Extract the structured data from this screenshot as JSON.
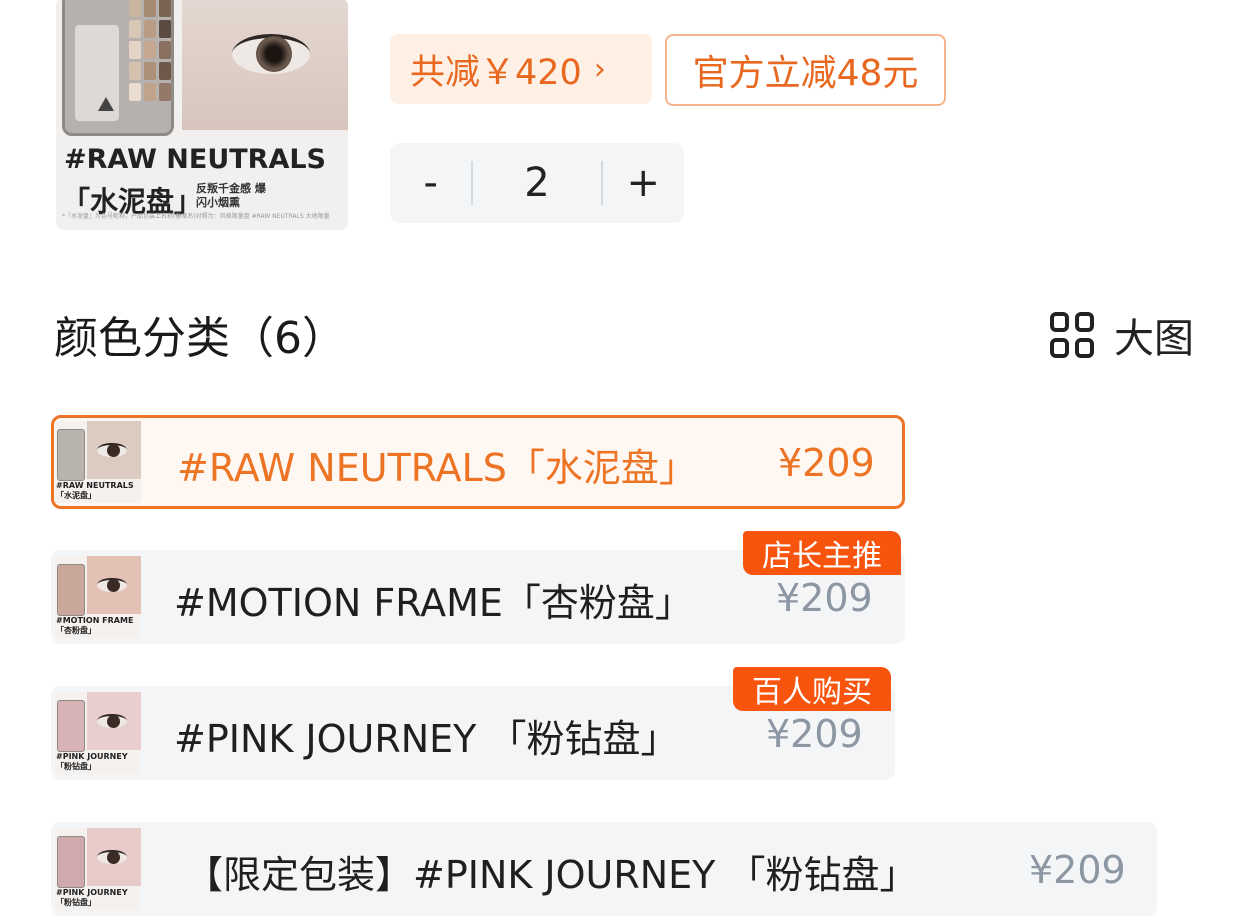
{
  "product": {
    "thumb_title": "#RAW NEUTRALS",
    "thumb_subtitle": "「水泥盘」",
    "thumb_desc": "反叛千金感 爆闪小烟熏",
    "thumb_footnote": "*「水泥盘」为色号昵称，产品包装上名称(备案名)对照为：风格限量盘 #RAW NEUTRALS 大地限量"
  },
  "price": {
    "coupon_total_label": "共减￥420",
    "coupon_total_chevron": "›",
    "coupon_official_label": "官方立减48元"
  },
  "quantity": {
    "minus": "-",
    "value": "2",
    "plus": "+"
  },
  "colors": {
    "title": "颜色分类（6）",
    "big_view_label": "大图",
    "options": [
      {
        "caption": "#RAW NEUTRALS\n「水泥盘」",
        "name": "#RAW NEUTRALS「水泥盘」",
        "price": "¥209",
        "badge": "",
        "selected": true
      },
      {
        "caption": "#MOTION FRAME\n「杏粉盘」",
        "name": "#MOTION FRAME「杏粉盘」",
        "price": "¥209",
        "badge": "店长主推",
        "selected": false
      },
      {
        "caption": "#PINK JOURNEY\n「粉钻盘」",
        "name": "#PINK JOURNEY 「粉钻盘」",
        "price": "¥209",
        "badge": "百人购买",
        "selected": false
      },
      {
        "caption": "#PINK JOURNEY\n「粉钻盘」",
        "name": "【限定包装】#PINK JOURNEY 「粉钻盘」",
        "price": "¥209",
        "badge": "",
        "selected": false
      }
    ]
  },
  "colors_accent": {
    "orange": "#ec7424",
    "badge_bg": "#f7540e",
    "coupon_bg": "#fff0e6",
    "row_bg": "#f3f5f7",
    "price_grey": "#8d96a3"
  }
}
